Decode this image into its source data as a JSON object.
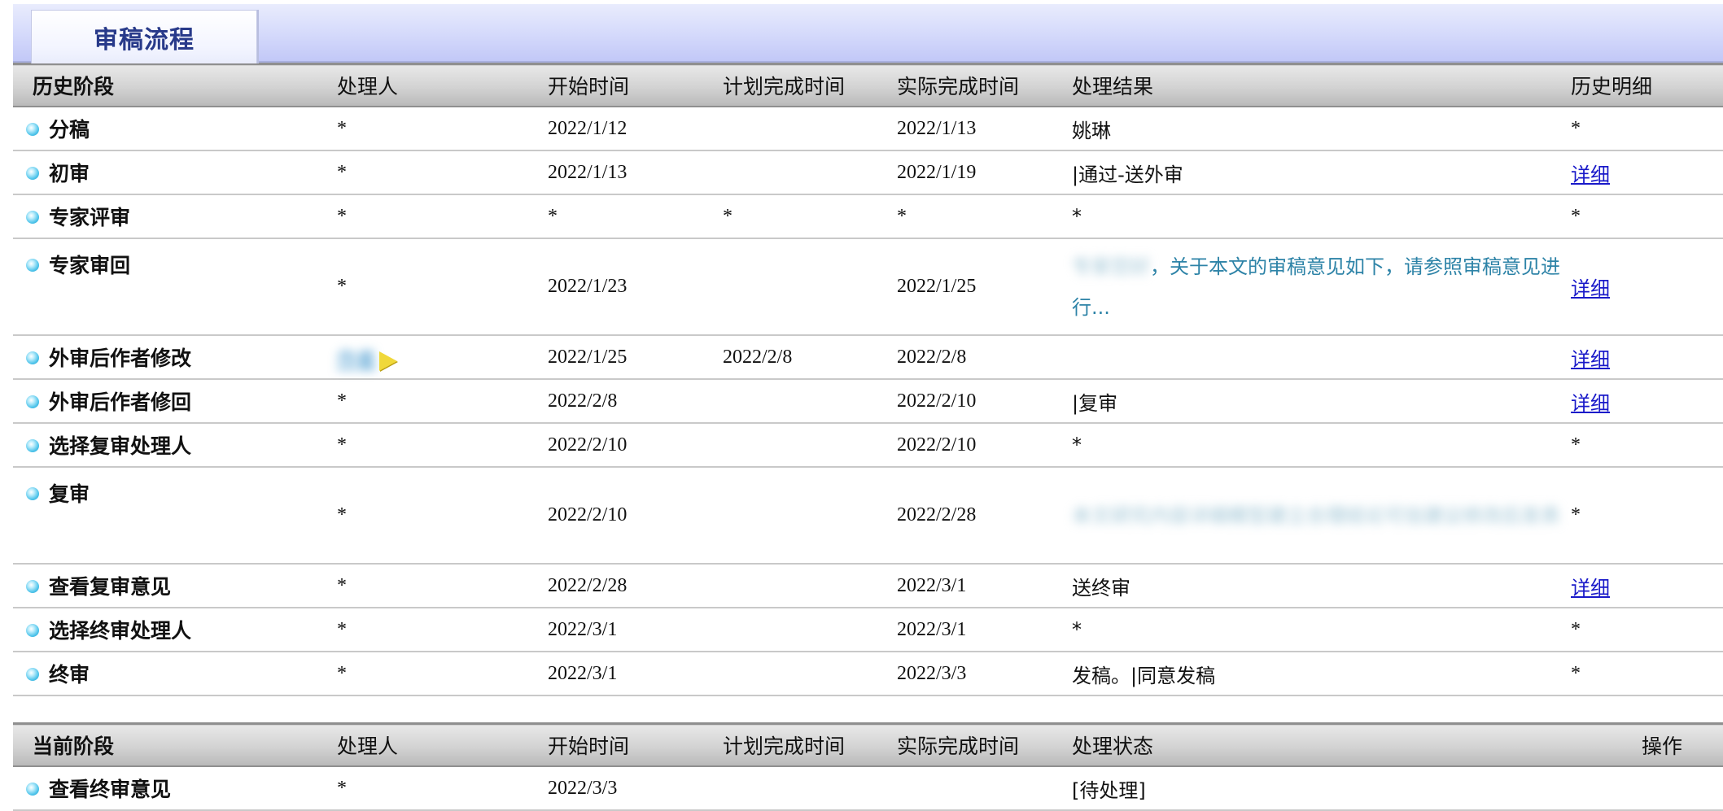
{
  "tab": {
    "title": "审稿流程"
  },
  "history": {
    "headers": [
      "历史阶段",
      "处理人",
      "开始时间",
      "计划完成时间",
      "实际完成时间",
      "处理结果",
      "历史明细"
    ],
    "rows": [
      {
        "stage": "分稿",
        "handler": "*",
        "start": "2022/1/12",
        "planned": "",
        "actual": "2022/1/13",
        "result": "姚琳",
        "detail": "*",
        "detail_link": false
      },
      {
        "stage": "初审",
        "handler": "*",
        "start": "2022/1/13",
        "planned": "",
        "actual": "2022/1/19",
        "result": "|通过-送外审",
        "detail": "详细",
        "detail_link": true
      },
      {
        "stage": "专家评审",
        "handler": "*",
        "start": "*",
        "planned": "*",
        "actual": "*",
        "result": "*",
        "detail": "*",
        "detail_link": false
      },
      {
        "stage": "专家审回",
        "handler": "*",
        "start": "2022/1/23",
        "planned": "",
        "actual": "2022/1/25",
        "result_blurred": "专家您好",
        "result": "，关于本文的审稿意见如下，请参照审稿意见进行...",
        "detail": "详细",
        "detail_link": true
      },
      {
        "stage": "外审后作者修改",
        "handler_blurred": "作者",
        "start": "2022/1/25",
        "planned": "2022/2/8",
        "actual": "2022/2/8",
        "result": "",
        "detail": "详细",
        "detail_link": true
      },
      {
        "stage": "外审后作者修回",
        "handler": "*",
        "start": "2022/2/8",
        "planned": "",
        "actual": "2022/2/10",
        "result": "|复审",
        "detail": "详细",
        "detail_link": true
      },
      {
        "stage": "选择复审处理人",
        "handler": "*",
        "start": "2022/2/10",
        "planned": "",
        "actual": "2022/2/10",
        "result": "*",
        "detail": "*",
        "detail_link": false
      },
      {
        "stage": "复审",
        "handler": "*",
        "start": "2022/2/10",
        "planned": "",
        "actual": "2022/2/28",
        "result_blurred": "本文研究内容详细模型建立合理结论可信建议修改后发表",
        "detail": "*",
        "detail_link": false
      },
      {
        "stage": "查看复审意见",
        "handler": "*",
        "start": "2022/2/28",
        "planned": "",
        "actual": "2022/3/1",
        "result": "送终审",
        "detail": "详细",
        "detail_link": true
      },
      {
        "stage": "选择终审处理人",
        "handler": "*",
        "start": "2022/3/1",
        "planned": "",
        "actual": "2022/3/1",
        "result": "*",
        "detail": "*",
        "detail_link": false
      },
      {
        "stage": "终审",
        "handler": "*",
        "start": "2022/3/1",
        "planned": "",
        "actual": "2022/3/3",
        "result": "发稿。|同意发稿",
        "detail": "*",
        "detail_link": false
      }
    ]
  },
  "current": {
    "headers": [
      "当前阶段",
      "处理人",
      "开始时间",
      "计划完成时间",
      "实际完成时间",
      "处理状态",
      "操作"
    ],
    "rows": [
      {
        "stage": "查看终审意见",
        "handler": "*",
        "start": "2022/3/3",
        "planned": "",
        "actual": "",
        "status": "[待处理]",
        "op": ""
      }
    ]
  }
}
